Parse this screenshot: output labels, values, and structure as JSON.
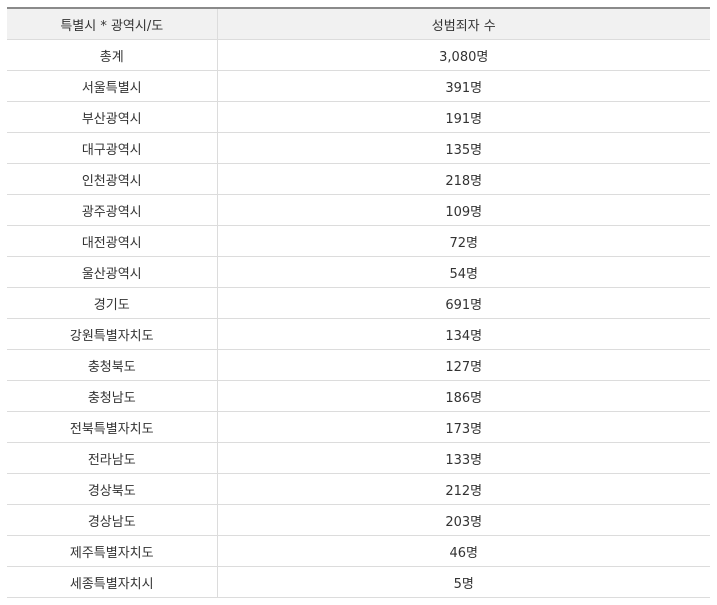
{
  "table": {
    "headers": [
      "특별시 * 광역시/도",
      "성범죄자 수"
    ],
    "rows": [
      {
        "region": "총계",
        "count": "3,080명"
      },
      {
        "region": "서울특별시",
        "count": "391명"
      },
      {
        "region": "부산광역시",
        "count": "191명"
      },
      {
        "region": "대구광역시",
        "count": "135명"
      },
      {
        "region": "인천광역시",
        "count": "218명"
      },
      {
        "region": "광주광역시",
        "count": "109명"
      },
      {
        "region": "대전광역시",
        "count": "72명"
      },
      {
        "region": "울산광역시",
        "count": "54명"
      },
      {
        "region": "경기도",
        "count": "691명"
      },
      {
        "region": "강원특별자치도",
        "count": "134명"
      },
      {
        "region": "충청북도",
        "count": "127명"
      },
      {
        "region": "충청남도",
        "count": "186명"
      },
      {
        "region": "전북특별자치도",
        "count": "173명"
      },
      {
        "region": "전라남도",
        "count": "133명"
      },
      {
        "region": "경상북도",
        "count": "212명"
      },
      {
        "region": "경상남도",
        "count": "203명"
      },
      {
        "region": "제주특별자치도",
        "count": "46명"
      },
      {
        "region": "세종특별자치시",
        "count": "5명"
      }
    ]
  }
}
